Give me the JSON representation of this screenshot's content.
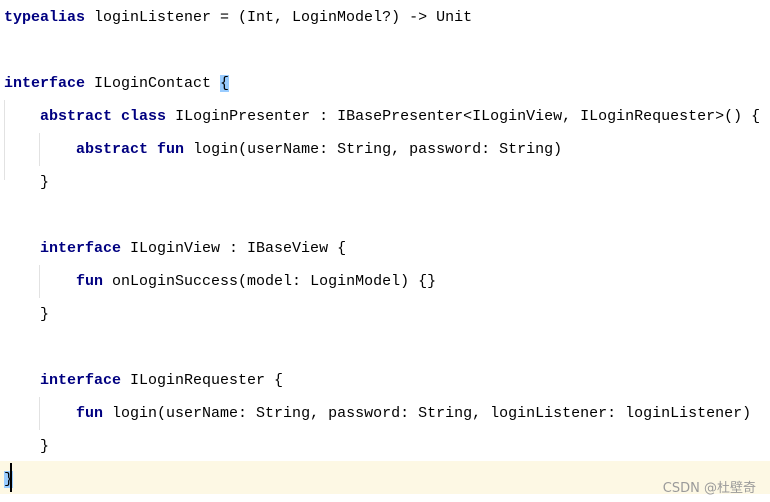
{
  "editor": {
    "lines": [
      {
        "tokens": [
          {
            "t": "typealias",
            "kw": true
          },
          {
            "t": " loginListener = (Int, LoginModel?) -> Unit"
          }
        ]
      },
      {
        "tokens": []
      },
      {
        "tokens": [
          {
            "t": "interface",
            "kw": true
          },
          {
            "t": " ILoginContact "
          },
          {
            "t": "{",
            "hl": true
          }
        ]
      },
      {
        "tokens": [
          {
            "t": "    "
          },
          {
            "t": "abstract",
            "kw": true
          },
          {
            "t": " "
          },
          {
            "t": "class",
            "kw": true
          },
          {
            "t": " ILoginPresenter : IBasePresenter<ILoginView, ILoginRequester>() {"
          }
        ]
      },
      {
        "tokens": [
          {
            "t": "        "
          },
          {
            "t": "abstract",
            "kw": true
          },
          {
            "t": " "
          },
          {
            "t": "fun",
            "kw": true
          },
          {
            "t": " login(userName: String, password: String)"
          }
        ]
      },
      {
        "tokens": [
          {
            "t": "    }"
          }
        ]
      },
      {
        "tokens": []
      },
      {
        "tokens": [
          {
            "t": "    "
          },
          {
            "t": "interface",
            "kw": true
          },
          {
            "t": " ILoginView : IBaseView {"
          }
        ]
      },
      {
        "tokens": [
          {
            "t": "        "
          },
          {
            "t": "fun",
            "kw": true
          },
          {
            "t": " onLoginSuccess(model: LoginModel) {}"
          }
        ]
      },
      {
        "tokens": [
          {
            "t": "    }"
          }
        ]
      },
      {
        "tokens": []
      },
      {
        "tokens": [
          {
            "t": "    "
          },
          {
            "t": "interface",
            "kw": true
          },
          {
            "t": " ILoginRequester {"
          }
        ]
      },
      {
        "tokens": [
          {
            "t": "        "
          },
          {
            "t": "fun",
            "kw": true
          },
          {
            "t": " login(userName: String, password: String, loginListener: loginListener)"
          }
        ]
      },
      {
        "tokens": [
          {
            "t": "    }"
          }
        ]
      },
      {
        "tokens": [
          {
            "t": "}",
            "hl": true
          }
        ]
      }
    ],
    "colors": {
      "keyword": "#000080",
      "caret_line": "#fdf8e4",
      "brace_match": "#99ccff"
    }
  },
  "watermark": "CSDN @杜壁奇"
}
